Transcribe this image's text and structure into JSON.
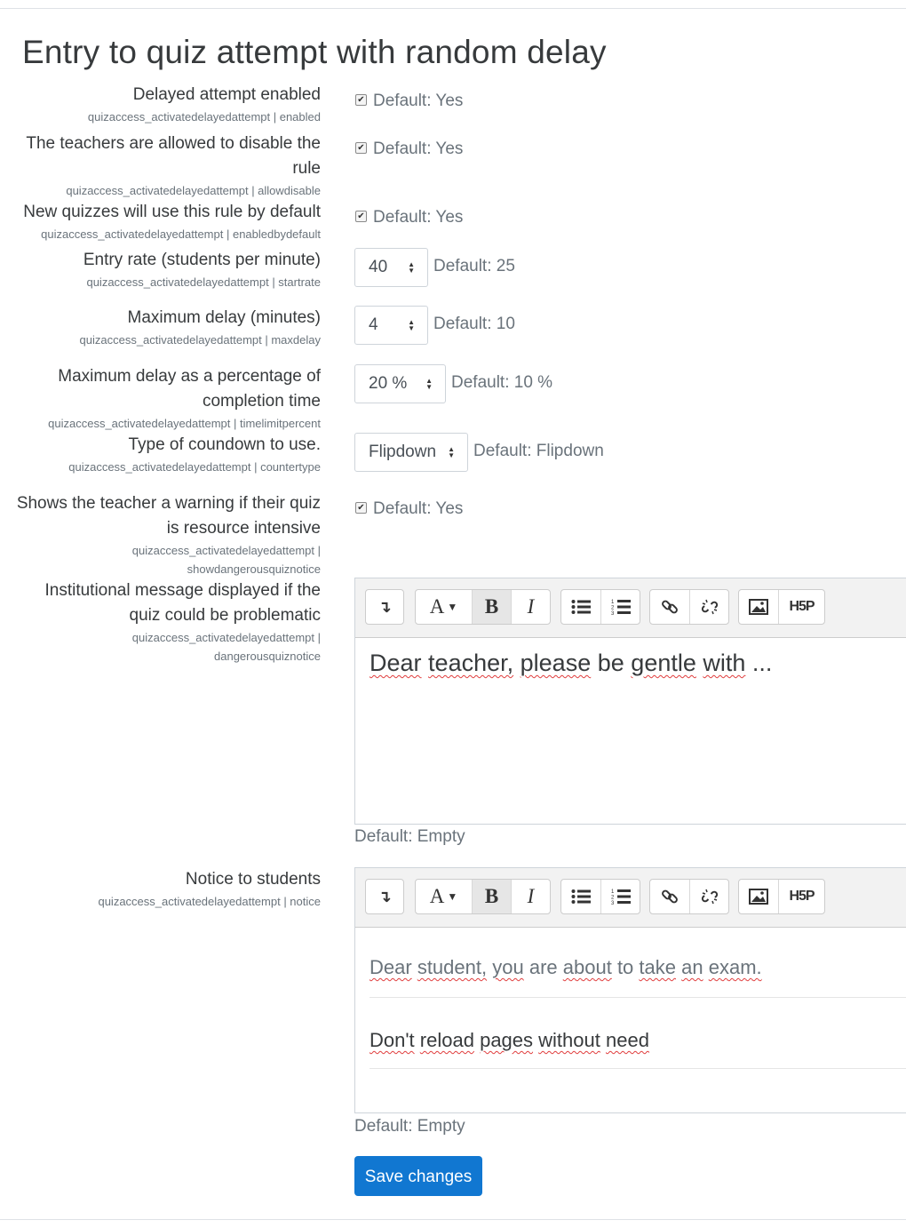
{
  "heading": "Entry to quiz attempt with random delay",
  "settings": {
    "enabled": {
      "label": "Delayed attempt enabled",
      "key": "quizaccess_activatedelayedattempt | enabled",
      "checked": true,
      "default": "Default: Yes"
    },
    "allowdisable": {
      "label_line1": "The teachers are allowed to disable the",
      "label_line2": "rule",
      "key": "quizaccess_activatedelayedattempt | allowdisable",
      "checked": true,
      "default": "Default: Yes"
    },
    "enabledbydefault": {
      "label": "New quizzes will use this rule by default",
      "key": "quizaccess_activatedelayedattempt | enabledbydefault",
      "checked": true,
      "default": "Default: Yes"
    },
    "startrate": {
      "label": "Entry rate (students per minute)",
      "key": "quizaccess_activatedelayedattempt | startrate",
      "value": "40",
      "default": "Default: 25"
    },
    "maxdelay": {
      "label": "Maximum delay (minutes)",
      "key": "quizaccess_activatedelayedattempt | maxdelay",
      "value": "4",
      "default": "Default: 10"
    },
    "timelimitpercent": {
      "label_line1": "Maximum delay as a percentage of",
      "label_line2": "completion time",
      "key": "quizaccess_activatedelayedattempt | timelimitpercent",
      "value": "20 %",
      "default": "Default: 10 %"
    },
    "countertype": {
      "label": "Type of coundown to use.",
      "key": "quizaccess_activatedelayedattempt | countertype",
      "value": "Flipdown",
      "default": "Default: Flipdown"
    },
    "showdangerousquiznotice": {
      "label_line1": "Shows the teacher a warning if their quiz",
      "label_line2": "is resource intensive",
      "key_line1": "quizaccess_activatedelayedattempt |",
      "key_line2": "showdangerousquiznotice",
      "checked": true,
      "default": "Default: Yes"
    },
    "dangerousquiznotice": {
      "label_line1": "Institutional message displayed if the",
      "label_line2": "quiz could be problematic",
      "key_line1": "quizaccess_activatedelayedattempt |",
      "key_line2": "dangerousquiznotice",
      "content_words": [
        "Dear",
        "teacher,",
        "please",
        "be",
        "gentle",
        "with",
        "..."
      ],
      "default": "Default: Empty"
    },
    "notice": {
      "label": "Notice to students",
      "key": "quizaccess_activatedelayedattempt | notice",
      "para1_words": [
        "Dear",
        "student,",
        "you",
        "are",
        "about",
        "to",
        "take",
        "an",
        "exam."
      ],
      "para2_words": [
        "Don't",
        "reload",
        "pages",
        "without",
        "need"
      ],
      "default": "Default: Empty"
    }
  },
  "toolbar": {
    "collapse_icon": "↴",
    "font_icon": "A",
    "bold": "B",
    "italic": "I",
    "link_icon": "link",
    "unlink_icon": "unlink",
    "image_icon": "image",
    "h5p_label": "H5P"
  },
  "save_label": "Save changes",
  "colors": {
    "primary": "#1177d1",
    "spellcheck": "#e03c3c"
  }
}
